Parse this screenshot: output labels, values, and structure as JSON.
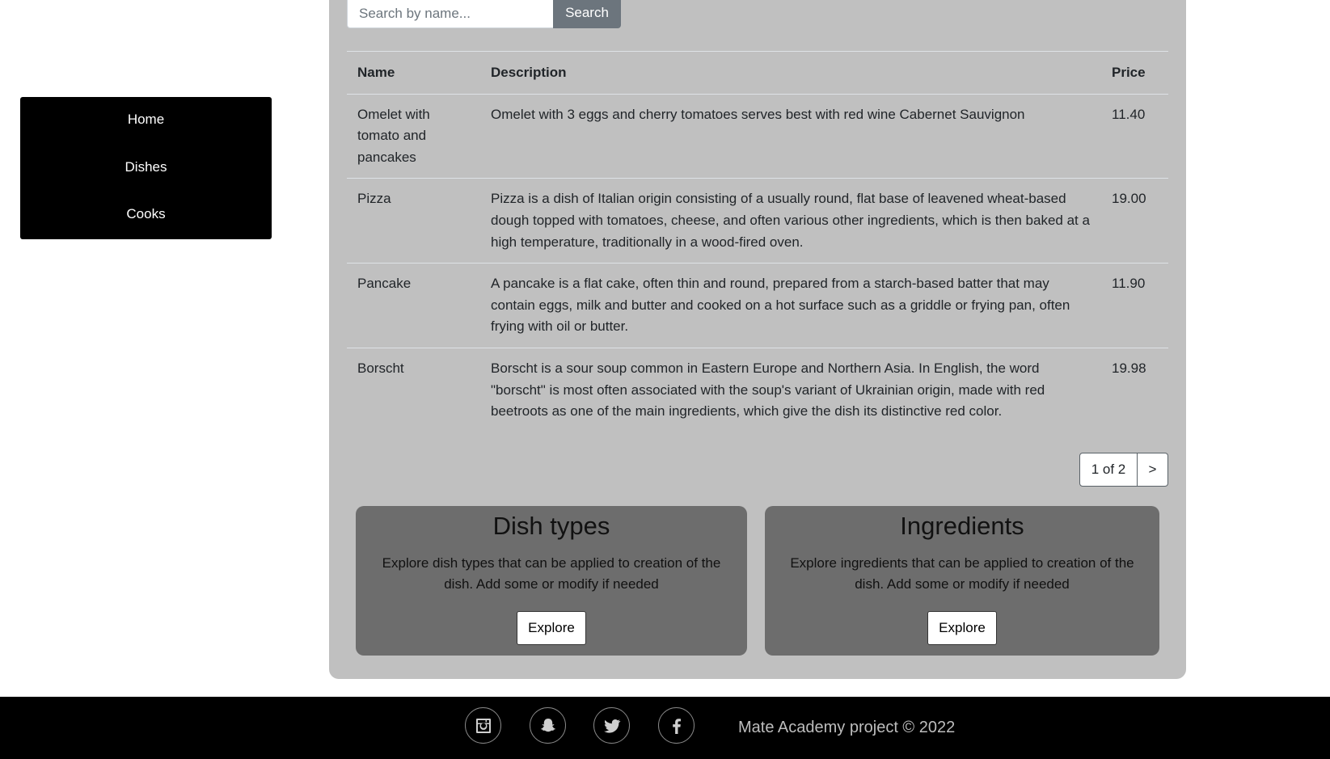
{
  "sidebar": {
    "items": [
      {
        "label": "Home"
      },
      {
        "label": "Dishes"
      },
      {
        "label": "Cooks"
      }
    ]
  },
  "search": {
    "placeholder": "Search by name...",
    "button_label": "Search"
  },
  "table": {
    "headers": {
      "name": "Name",
      "description": "Description",
      "price": "Price"
    },
    "rows": [
      {
        "name": "Omelet with tomato and pancakes",
        "description": "Omelet with 3 eggs and cherry tomatoes serves best with red wine Cabernet Sauvignon",
        "price": "11.40"
      },
      {
        "name": "Pizza",
        "description": "Pizza is a dish of Italian origin consisting of a usually round, flat base of leavened wheat-based dough topped with tomatoes, cheese, and often various other ingredients, which is then baked at a high temperature, traditionally in a wood-fired oven.",
        "price": "19.00"
      },
      {
        "name": "Pancake",
        "description": "A pancake is a flat cake, often thin and round, prepared from a starch-based batter that may contain eggs, milk and butter and cooked on a hot surface such as a griddle or frying pan, often frying with oil or butter.",
        "price": "11.90"
      },
      {
        "name": "Borscht",
        "description": "Borscht is a sour soup common in Eastern Europe and Northern Asia. In English, the word \"borscht\" is most often associated with the soup's variant of Ukrainian origin, made with red beetroots as one of the main ingredients, which give the dish its distinctive red color.",
        "price": "19.98"
      }
    ]
  },
  "pagination": {
    "info": "1 of 2",
    "next_label": ">"
  },
  "cards": [
    {
      "title": "Dish types",
      "text": "Explore dish types that can be applied to creation of the dish. Add some or modify if needed",
      "button_label": "Explore"
    },
    {
      "title": "Ingredients",
      "text": "Explore ingredients that can be applied to creation of the dish. Add some or modify if needed",
      "button_label": "Explore"
    }
  ],
  "footer": {
    "social_icons": [
      "instagram-icon",
      "snapchat-icon",
      "twitter-icon",
      "facebook-icon"
    ],
    "copyright": "Mate Academy project © 2022"
  },
  "colors": {
    "sidebar_bg": "#000000",
    "main_bg": "#c0c0c0",
    "card_bg": "#6d6d6d",
    "search_button_bg": "#6c757d",
    "footer_bg": "#000000"
  }
}
